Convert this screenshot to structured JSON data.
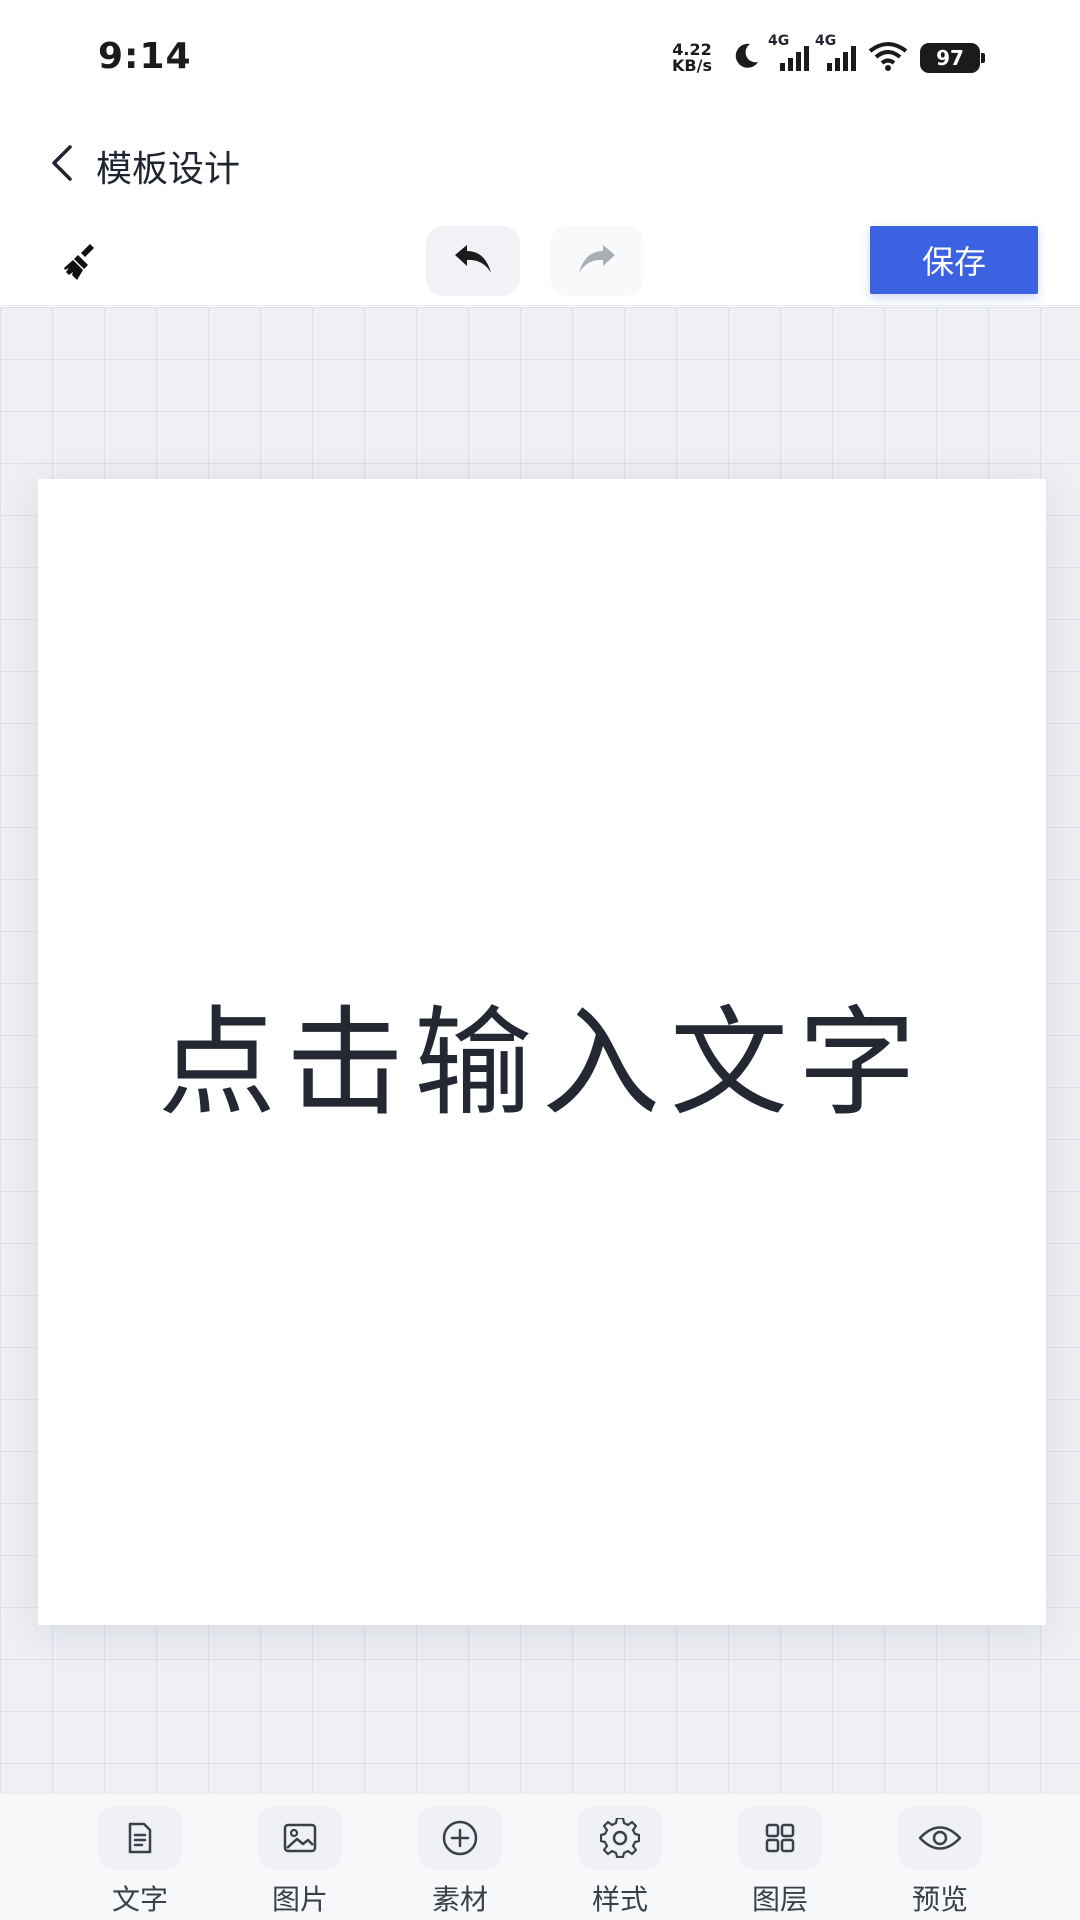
{
  "status_bar": {
    "time": "9:14",
    "net_speed_value": "4.22",
    "net_speed_unit": "KB/s",
    "sim1_label": "4G",
    "sim2_label": "4G",
    "battery": "97"
  },
  "header": {
    "title": "模板设计"
  },
  "toolbar": {
    "save_label": "保存"
  },
  "canvas": {
    "text": "点击输入文字"
  },
  "bottom_nav": {
    "items": [
      {
        "label": "文字",
        "icon": "text-icon"
      },
      {
        "label": "图片",
        "icon": "image-icon"
      },
      {
        "label": "素材",
        "icon": "add-circle-icon"
      },
      {
        "label": "样式",
        "icon": "gear-icon"
      },
      {
        "label": "图层",
        "icon": "layers-icon"
      },
      {
        "label": "预览",
        "icon": "eye-icon"
      }
    ]
  },
  "colors": {
    "accent": "#3b62e0",
    "canvas_bg": "#eef0f4",
    "grid_line": "#dde0e6"
  }
}
